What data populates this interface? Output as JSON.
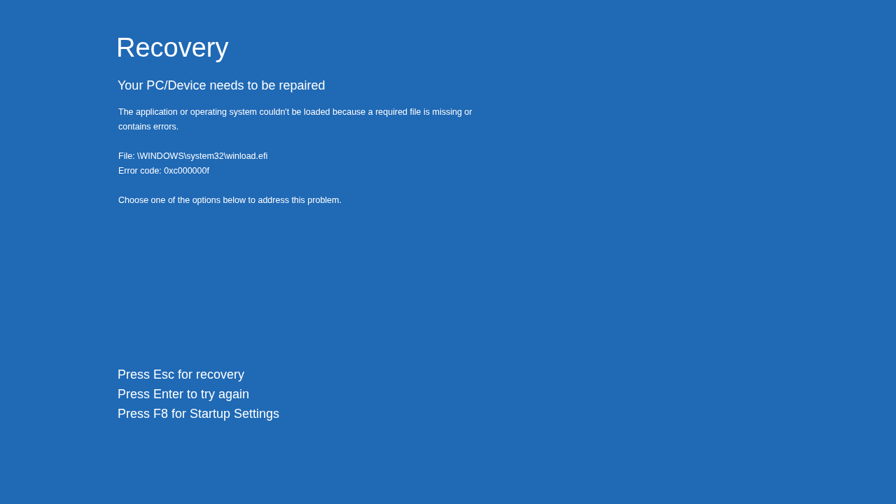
{
  "title": "Recovery",
  "subtitle": "Your PC/Device needs to be repaired",
  "message": "The application or operating system couldn't be loaded because a required file is missing or contains errors.",
  "details": [
    "File: \\WINDOWS\\system32\\winload.efi",
    "Error code: 0xc000000f"
  ],
  "instruction": "Choose one of the options below to address this problem.",
  "options": [
    "Press Esc for recovery",
    "Press Enter to try again",
    "Press F8 for Startup Settings"
  ]
}
